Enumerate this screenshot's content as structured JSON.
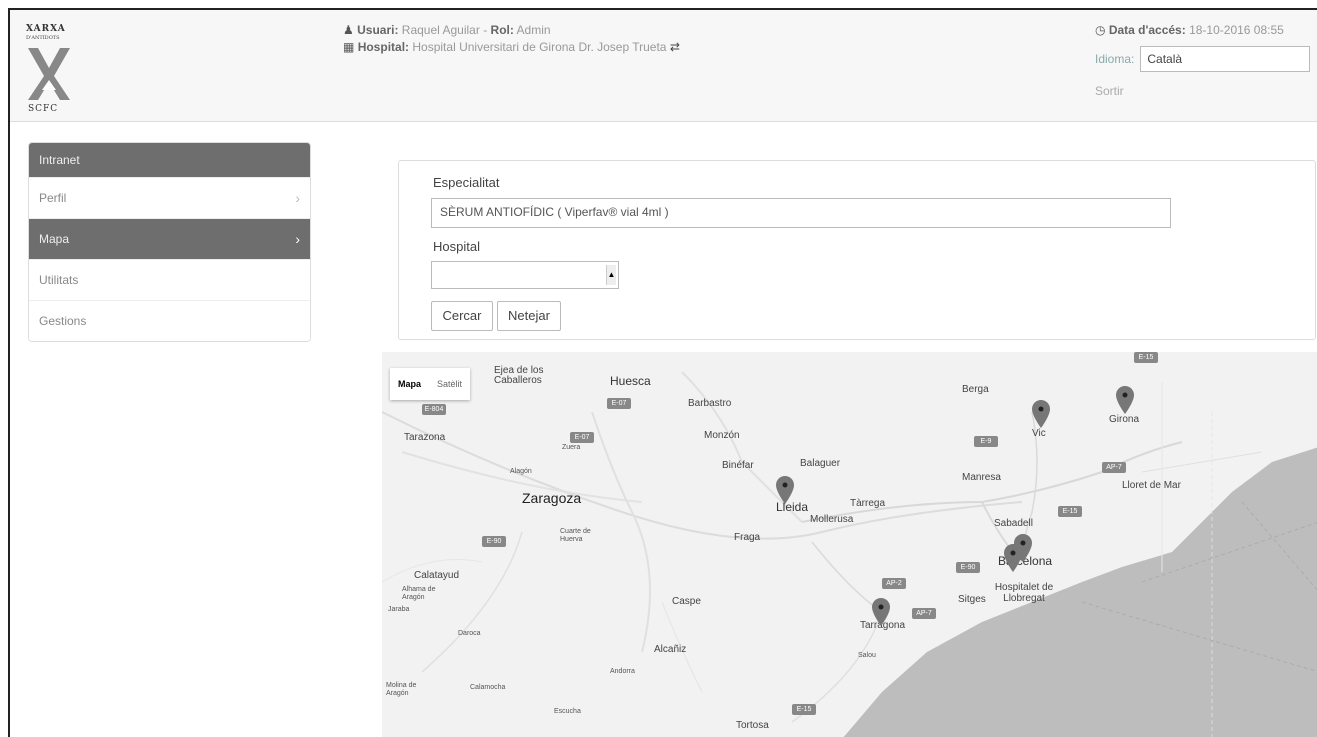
{
  "logo": {
    "line1": "XARXA",
    "line2": "D'ANTÍDOTS",
    "line3": "SCFC"
  },
  "header": {
    "user_label": "Usuari:",
    "user_name": "Raquel Aguilar",
    "separator": "-",
    "role_label": "Rol:",
    "role": "Admin",
    "hospital_label": "Hospital:",
    "hospital": "Hospital Universitari de Girona Dr. Josep Trueta",
    "access_label": "Data d'accés:",
    "access_date": "18-10-2016 08:55",
    "language_label": "Idioma:",
    "language": "Català",
    "logout": "Sortir"
  },
  "sidebar": {
    "heading": "Intranet",
    "items": [
      {
        "label": "Perfil",
        "active": false,
        "chevron": "›"
      },
      {
        "label": "Mapa",
        "active": true,
        "chevron": "›"
      },
      {
        "label": "Utilitats",
        "active": false,
        "chevron": ""
      },
      {
        "label": "Gestions",
        "active": false,
        "chevron": ""
      }
    ]
  },
  "search_form": {
    "specialty_label": "Especialitat",
    "specialty_value": "SÈRUM ANTIOFÍDIC ( Viperfav® vial 4ml )",
    "hospital_label": "Hospital",
    "hospital_value": "",
    "search_button": "Cercar",
    "clear_button": "Netejar"
  },
  "map": {
    "type_map": "Mapa",
    "type_satellite": "Satèlit",
    "places": {
      "ejea": "Ejea de los Caballeros",
      "huesca": "Huesca",
      "barbastro": "Barbastro",
      "berga": "Berga",
      "tarazona": "Tarazona",
      "zuera": "Zuera",
      "monzon": "Monzón",
      "vic": "Vic",
      "girona": "Girona",
      "alagon": "Alagón",
      "binefar": "Binéfar",
      "balaguer": "Balaguer",
      "manresa": "Manresa",
      "lloret": "Lloret de Mar",
      "zaragoza": "Zaragoza",
      "lleida": "Lleida",
      "tarrega": "Tàrrega",
      "mollerusa": "Mollerusa",
      "sabadell": "Sabadell",
      "cuarte": "Cuarte de Huerva",
      "fraga": "Fraga",
      "barcelona": "Barcelona",
      "calatayud": "Calatayud",
      "alhama": "Alhama de Aragón",
      "ateca": "Jaraba",
      "hospitalet": "Hospitalet de Llobregat",
      "sitges": "Sitges",
      "caspe": "Caspe",
      "tarragona": "Tarragona",
      "daroca": "Daroca",
      "alcaniz": "Alcañiz",
      "salou": "Salou",
      "andorra": "Andorra",
      "calamocha": "Calamocha",
      "molina": "Molina de Aragón",
      "escucha": "Escucha",
      "tortosa": "Tortosa"
    },
    "roads": [
      "E-804",
      "E-07",
      "E-07",
      "E-9",
      "AP-7",
      "E-15",
      "E-90",
      "E-90",
      "AP-2",
      "AP-7",
      "E-15",
      "E-15"
    ]
  }
}
